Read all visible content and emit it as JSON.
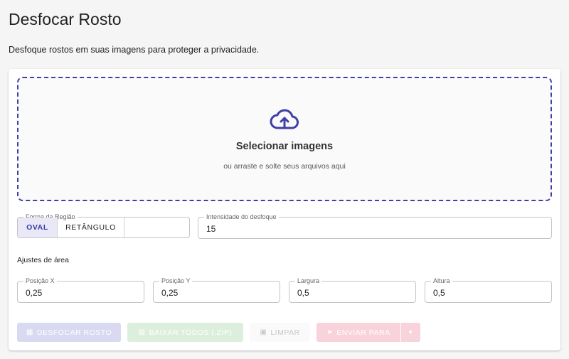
{
  "page": {
    "title": "Desfocar Rosto",
    "subtitle": "Desfoque rostos em suas imagens para proteger a privacidade."
  },
  "dropzone": {
    "title": "Selecionar imagens",
    "hint": "ou arraste e solte seus arquivos aqui",
    "icon": "cloud-upload-icon",
    "accent": "#3f3fa8"
  },
  "shape": {
    "legend": "Forma da Região",
    "options": [
      "OVAL",
      "RETÂNGULO"
    ],
    "selected": "OVAL"
  },
  "intensity": {
    "legend": "Intensidade do desfoque",
    "value": "15"
  },
  "area": {
    "label": "Ajustes de área",
    "fields": [
      {
        "legend": "Posição X",
        "value": "0,25"
      },
      {
        "legend": "Posição Y",
        "value": "0,25"
      },
      {
        "legend": "Largura",
        "value": "0,5"
      },
      {
        "legend": "Altura",
        "value": "0,5"
      }
    ]
  },
  "actions": {
    "blur": "DESFOCAR ROSTO",
    "download": "BAIXAR TODOS (.ZIP)",
    "clear": "LIMPAR",
    "send": "ENVIAR PARA"
  }
}
